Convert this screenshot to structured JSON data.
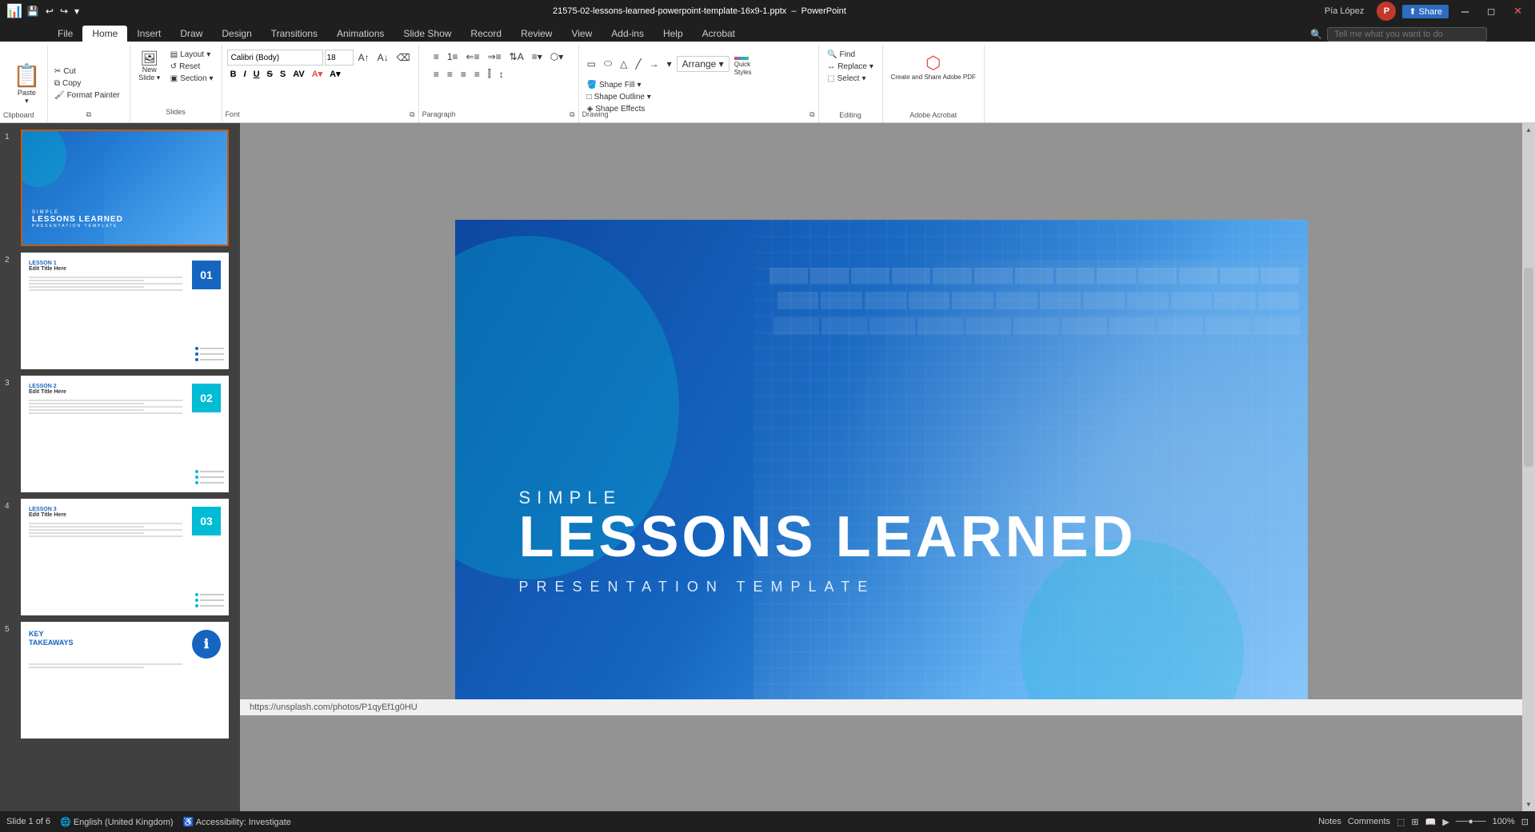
{
  "titlebar": {
    "filename": "21575-02-lessons-learned-powerpoint-template-16x9-1.pptx",
    "app": "PowerPoint",
    "user": "Pía López"
  },
  "tabs": [
    "File",
    "Home",
    "Insert",
    "Draw",
    "Design",
    "Transitions",
    "Animations",
    "Slide Show",
    "Record",
    "Review",
    "View",
    "Add-ins",
    "Help",
    "Acrobat"
  ],
  "active_tab": "Home",
  "search_placeholder": "Tell me what you want to do",
  "ribbon": {
    "clipboard": {
      "label": "Clipboard",
      "paste": "Paste",
      "cut": "Cut",
      "copy": "Copy",
      "format_painter": "Format Painter"
    },
    "slides": {
      "label": "Slides",
      "new_slide": "New Slide",
      "layout": "Layout",
      "reset": "Reset",
      "section": "Section"
    },
    "font": {
      "label": "Font",
      "font_name": "Calibri (Body)",
      "font_size": "18",
      "bold": "B",
      "italic": "I",
      "underline": "U",
      "strikethrough": "S",
      "shadow": "S",
      "increase": "A",
      "decrease": "A"
    },
    "paragraph": {
      "label": "Paragraph",
      "align_text": "Align Text",
      "text_direction": "Text Direction",
      "convert_smartart": "Convert to SmartArt",
      "bullets": "Bullets",
      "numbering": "Numbering",
      "indent_less": "Indent Less",
      "indent_more": "Indent More"
    },
    "drawing": {
      "label": "Drawing",
      "arrange": "Arrange",
      "quick_styles": "Quick Styles",
      "shape_fill": "Shape Fill",
      "shape_outline": "Shape Outline",
      "shape_effects": "Shape Effects"
    },
    "editing": {
      "label": "Editing",
      "find": "Find",
      "replace": "Replace",
      "select": "Select"
    },
    "adobe": {
      "label": "Adobe Acrobat",
      "create_share": "Create and Share Adobe PDF"
    }
  },
  "slides": [
    {
      "number": "1",
      "active": true,
      "type": "title",
      "title1": "SIMPLE",
      "title2": "LESSONS LEARNED",
      "subtitle": "PRESENTATION TEMPLATE"
    },
    {
      "number": "2",
      "type": "lesson",
      "lesson_label": "LESSON 1",
      "lesson_title": "Edit Title Here",
      "lesson_num": "01",
      "num_color": "blue"
    },
    {
      "number": "3",
      "type": "lesson",
      "lesson_label": "LESSON 2",
      "lesson_title": "Edit Title Here",
      "lesson_num": "02",
      "num_color": "teal"
    },
    {
      "number": "4",
      "type": "lesson",
      "lesson_label": "LESSON 3",
      "lesson_title": "Edit Title Here",
      "lesson_num": "03",
      "num_color": "teal"
    },
    {
      "number": "5",
      "type": "key",
      "key_label": "KEY",
      "key_label2": "TAKEAWAYS",
      "num_color": "blue"
    }
  ],
  "main_slide": {
    "simple": "SIMPLE",
    "lessons": "LESSONS LEARNED",
    "template": "PRESENTATION TEMPLATE"
  },
  "url": "https://unsplash.com/photos/P1qyEf1g0HU",
  "status": {
    "slide_info": "Slide 1 of 6",
    "language": "English (United Kingdom)",
    "accessibility": "Accessibility: Investigate",
    "zoom": "100%",
    "notes": "Notes",
    "comments": "Comments"
  }
}
